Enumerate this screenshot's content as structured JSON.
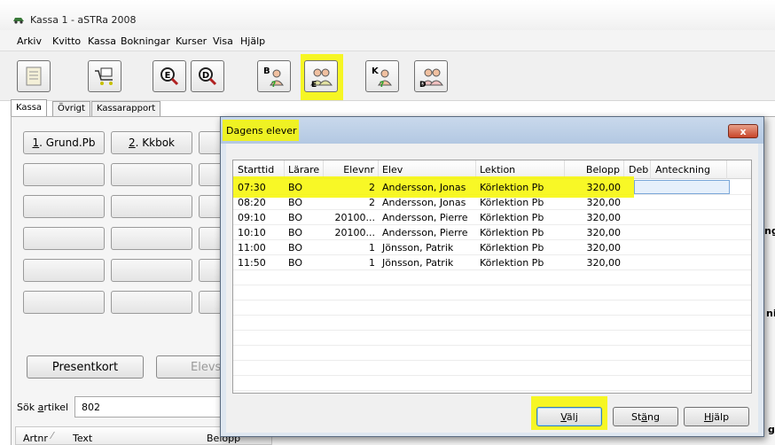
{
  "window": {
    "title": "Kassa 1 - aSTRa 2008"
  },
  "menu": [
    "Arkiv",
    "Kvitto",
    "Kassa",
    "Bokningar",
    "Kurser",
    "Visa",
    "Hjälp"
  ],
  "toolbar": {
    "buttons": [
      {
        "icon": "notepad-icon",
        "letter": ""
      },
      {
        "icon": "cart-icon",
        "letter": ""
      },
      {
        "icon": "magnifier-e-icon",
        "letter": "E"
      },
      {
        "icon": "magnifier-d-icon",
        "letter": "D"
      },
      {
        "icon": "person-b-icon",
        "letter": "B"
      },
      {
        "icon": "persons-e-icon",
        "letter": "E"
      },
      {
        "icon": "person-k-icon",
        "letter": "K"
      },
      {
        "icon": "persons-d-icon",
        "letter": "D"
      }
    ],
    "highlight_color": "#f7f700"
  },
  "tabs": [
    "Kassa",
    "Övrigt",
    "Kassarapport"
  ],
  "kassa": {
    "grund_btn": {
      "key": "1",
      "rest": ". Grund.Pb"
    },
    "kkbok_btn": {
      "key": "2",
      "rest": ". Kkbok"
    },
    "presentkort": "Presentkort",
    "elevs": "Elevs",
    "search_label_pre": "Sök ",
    "search_label_key": "a",
    "search_label_post": "rtikel",
    "search_value": "802",
    "list_cols": [
      "Artnr",
      "Text",
      "Belopp"
    ],
    "right_fragments": [
      "ng",
      "ni",
      "g"
    ]
  },
  "dialog": {
    "title": "Dagens elever",
    "columns": [
      "Starttid",
      "Lärare",
      "Elevnr",
      "Elev",
      "Lektion",
      "Belopp",
      "Deb",
      "Anteckning"
    ],
    "rows": [
      {
        "start": "07:30",
        "teacher": "BO",
        "elevnr": "2",
        "elev": "Andersson, Jonas",
        "lektion": "Körlektion Pb",
        "belopp": "320,00",
        "selected": true
      },
      {
        "start": "08:20",
        "teacher": "BO",
        "elevnr": "2",
        "elev": "Andersson, Jonas",
        "lektion": "Körlektion Pb",
        "belopp": "320,00"
      },
      {
        "start": "09:10",
        "teacher": "BO",
        "elevnr": "20100...",
        "elev": "Andersson, Pierre",
        "lektion": "Körlektion Pb",
        "belopp": "320,00"
      },
      {
        "start": "10:10",
        "teacher": "BO",
        "elevnr": "20100...",
        "elev": "Andersson, Pierre",
        "lektion": "Körlektion Pb",
        "belopp": "320,00"
      },
      {
        "start": "11:00",
        "teacher": "BO",
        "elevnr": "1",
        "elev": "Jönsson, Patrik",
        "lektion": "Körlektion Pb",
        "belopp": "320,00"
      },
      {
        "start": "11:50",
        "teacher": "BO",
        "elevnr": "1",
        "elev": "Jönsson, Patrik",
        "lektion": "Körlektion Pb",
        "belopp": "320,00"
      }
    ],
    "buttons": {
      "valj": {
        "key": "V",
        "rest": "älj"
      },
      "stang": {
        "pre": "St",
        "key": "ä",
        "rest": "ng"
      },
      "hjalp": {
        "key": "H",
        "rest": "jälp"
      }
    },
    "close_label": "x"
  }
}
